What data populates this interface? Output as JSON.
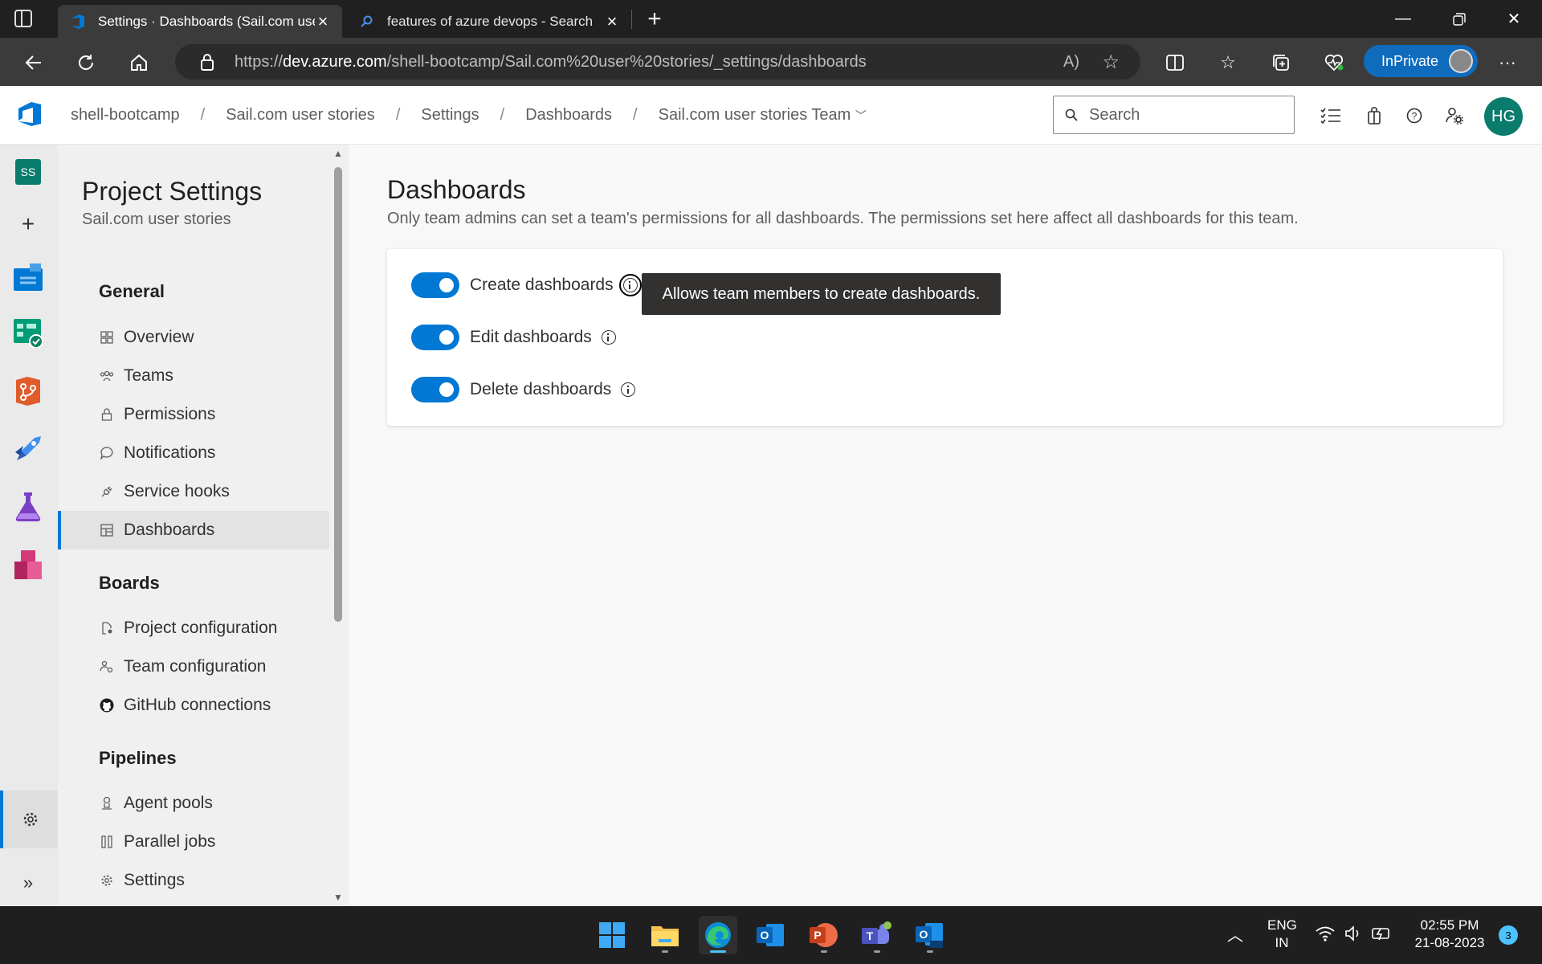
{
  "browser": {
    "tabs": [
      {
        "title": "Settings · Dashboards (Sail.com user stories)",
        "active": true
      },
      {
        "title": "features of azure devops - Search",
        "active": false
      }
    ],
    "url_prefix": "https://",
    "url_host": "dev.azure.com",
    "url_path": "/shell-bootcamp/Sail.com%20user%20stories/_settings/dashboards",
    "inprivate_label": "InPrivate"
  },
  "header": {
    "breadcrumb": [
      "shell-bootcamp",
      "Sail.com user stories",
      "Settings",
      "Dashboards",
      "Sail.com user stories Team"
    ],
    "search_placeholder": "Search",
    "avatar_initials": "HG",
    "accent_color": "#0078d4"
  },
  "rail": {
    "project_initials": "SS",
    "items": [
      "overview",
      "boards",
      "repos",
      "pipelines",
      "test-plans",
      "artifacts"
    ]
  },
  "sidenav": {
    "title": "Project Settings",
    "subtitle": "Sail.com user stories",
    "groups": [
      {
        "label": "General",
        "items": [
          "Overview",
          "Teams",
          "Permissions",
          "Notifications",
          "Service hooks",
          "Dashboards"
        ]
      },
      {
        "label": "Boards",
        "items": [
          "Project configuration",
          "Team configuration",
          "GitHub connections"
        ]
      },
      {
        "label": "Pipelines",
        "items": [
          "Agent pools",
          "Parallel jobs",
          "Settings"
        ]
      }
    ],
    "selected": "Dashboards"
  },
  "main": {
    "title": "Dashboards",
    "description": "Only team admins can set a team's permissions for all dashboards. The permissions set here affect all dashboards for this team.",
    "toggles": [
      {
        "label": "Create dashboards",
        "on": true
      },
      {
        "label": "Edit dashboards",
        "on": true
      },
      {
        "label": "Delete dashboards",
        "on": true
      }
    ],
    "tooltip": "Allows team members to create dashboards."
  },
  "taskbar": {
    "lang_line1": "ENG",
    "lang_line2": "IN",
    "time": "02:55 PM",
    "date": "21-08-2023",
    "notifications": "3"
  }
}
